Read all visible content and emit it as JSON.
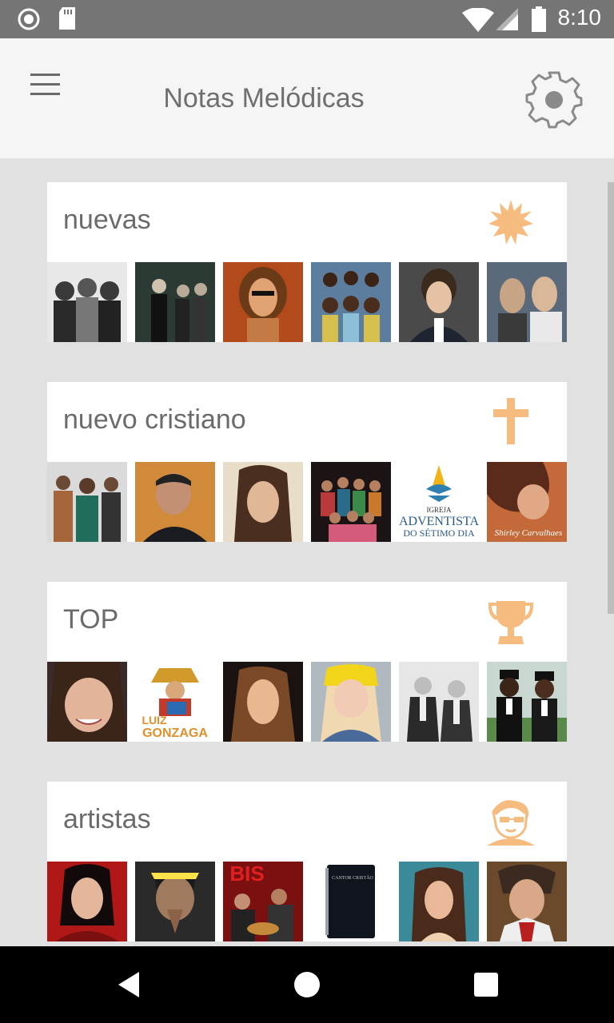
{
  "status_bar": {
    "time": "8:10",
    "icons": [
      "radio-icon",
      "sd-card-icon",
      "wifi-icon",
      "signal-icon",
      "battery-icon"
    ]
  },
  "app_bar": {
    "title": "Notas Melódicas",
    "menu_icon": "hamburger-icon",
    "settings_icon": "gear-icon"
  },
  "colors": {
    "accent": "#f5bb7f",
    "status_bar": "#757575",
    "app_bar": "#f5f5f5",
    "background": "#e1e1e1",
    "card": "#ffffff",
    "nav_bar": "#000000"
  },
  "cards": [
    {
      "title": "nuevas",
      "icon": "starburst-icon",
      "thumbs": 6
    },
    {
      "title": "nuevo cristiano",
      "icon": "cross-icon",
      "thumbs": 6
    },
    {
      "title": "TOP",
      "icon": "trophy-icon",
      "thumbs": 6
    },
    {
      "title": "artistas",
      "icon": "singer-face-icon",
      "thumbs": 6
    }
  ],
  "thumb_texts": {
    "adventist_line1": "IGREJA",
    "adventist_line2": "ADVENTISTA",
    "adventist_line3": "DO SÉTIMO DIA",
    "shirley": "Shirley Carvalhaes",
    "luiz": "LUIZ",
    "gonzaga": "GONZAGA",
    "bis": "BIS",
    "cantor": "CANTOR CRISTÃO"
  },
  "nav_bar": {
    "icons": [
      "back-icon",
      "home-icon",
      "recents-icon"
    ]
  }
}
